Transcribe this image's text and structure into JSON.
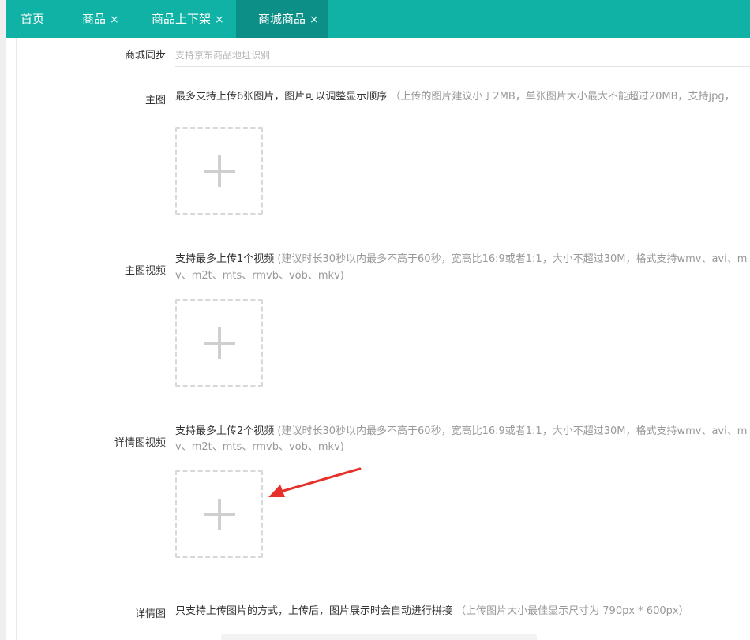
{
  "tabs": [
    {
      "label": "首页",
      "closable": false
    },
    {
      "label": "商品",
      "closable": true
    },
    {
      "label": "商品上下架",
      "closable": true
    },
    {
      "label": "商城商品",
      "closable": true,
      "active": true
    }
  ],
  "close_glyph": "×",
  "form": {
    "sync": {
      "label": "商城同步",
      "placeholder": "支持京东商品地址识别"
    },
    "main_image": {
      "label": "主图",
      "primary": "最多支持上传6张图片，图片可以调整显示顺序",
      "hint": "（上传的图片建议小于2MB，单张图片大小最大不能超过20MB，支持jpg，"
    },
    "main_video": {
      "label": "主图视频",
      "primary": "支持最多上传1个视频",
      "hint_line1": "(建议时长30秒以内最多不高于60秒，宽高比16:9或者1:1，大小不超过30M，格式支持wmv、avi、m",
      "hint_line2": "v、m2t、mts、rmvb、vob、mkv)"
    },
    "detail_video": {
      "label": "详情图视频",
      "primary": "支持最多上传2个视频",
      "hint_line1": "(建议时长30秒以内最多不高于60秒，宽高比16:9或者1:1，大小不超过30M，格式支持wmv、avi、m",
      "hint_line2": "v、m2t、mts、rmvb、vob、mkv)"
    },
    "detail_image": {
      "label": "详情图",
      "primary": "只支持上传图片的方式，上传后，图片展示时会自动进行拼接",
      "hint": "（上传图片大小最佳显示尺寸为 790px * 600px）"
    }
  },
  "colors": {
    "tabbar": "#11b2a6",
    "tab_active": "#0b8f86",
    "annotation_arrow": "#e8302a"
  },
  "icons": {
    "upload": "plus-icon",
    "close": "close-icon",
    "annotation": "red-arrow-icon"
  }
}
